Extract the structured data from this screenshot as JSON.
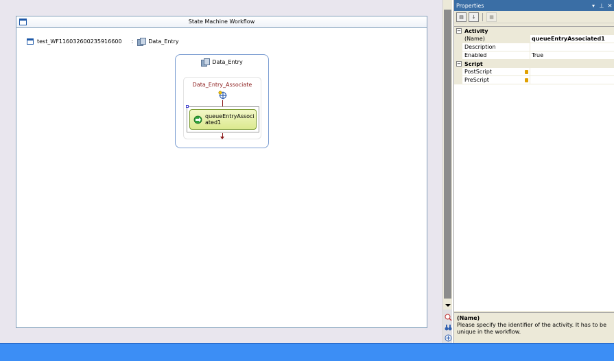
{
  "workflow": {
    "title": "State Machine Workflow",
    "breadcrumb": {
      "workflow_name": "test_WF116032600235916600",
      "separator": ":",
      "state_name": "Data_Entry"
    },
    "state": {
      "name": "Data_Entry",
      "event_driven": {
        "name": "Data_Entry_Associate",
        "activity_label": "queueEntryAssociated1"
      }
    }
  },
  "properties": {
    "title": "Properties",
    "categories": [
      {
        "name": "Activity",
        "toggle": "−",
        "rows": [
          {
            "name": "(Name)",
            "value": "queueEntryAssociated1"
          },
          {
            "name": "Description",
            "value": ""
          },
          {
            "name": "Enabled",
            "value": "True"
          }
        ]
      },
      {
        "name": "Script",
        "toggle": "−",
        "rows": [
          {
            "name": "PostScript",
            "value": ""
          },
          {
            "name": "PreScript",
            "value": ""
          }
        ]
      }
    ],
    "description": {
      "title": "(Name)",
      "text": "Please specify the identifier of the activity. It has to be unique in the workflow."
    }
  },
  "colors": {
    "status_bar": "#3c8ef5",
    "titlebar": "#3a6ea5",
    "event_title": "#8b1a1a",
    "activity_fill": "#dbe98f"
  }
}
